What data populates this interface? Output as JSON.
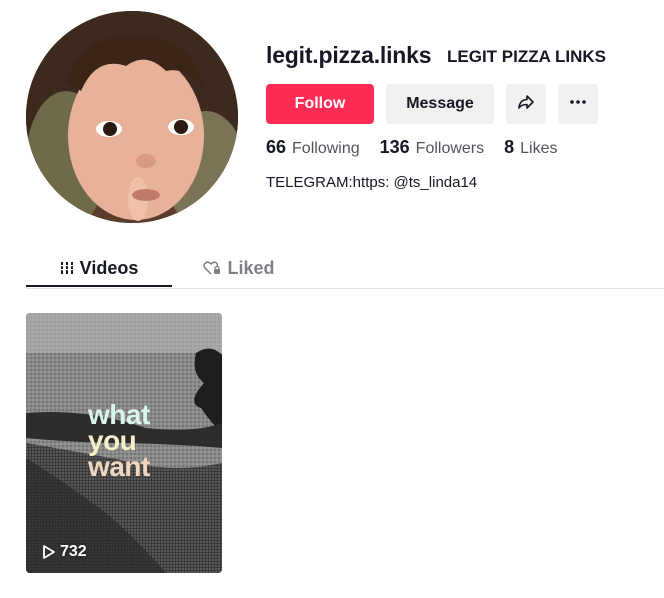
{
  "profile": {
    "username": "legit.pizza.links",
    "nickname": "LEGIT PIZZA LINKS",
    "bio": "TELEGRAM:https: @ts_linda14",
    "avatar_icon": "child-portrait-avatar"
  },
  "actions": {
    "follow_label": "Follow",
    "message_label": "Message",
    "share_icon": "share-arrow-icon",
    "more_icon": "more-dots-icon"
  },
  "stats": {
    "following": {
      "value": "66",
      "label": "Following"
    },
    "followers": {
      "value": "136",
      "label": "Followers"
    },
    "likes": {
      "value": "8",
      "label": "Likes"
    }
  },
  "tabs": [
    {
      "label": "Videos",
      "icon": "grid-bars-icon",
      "active": true
    },
    {
      "label": "Liked",
      "icon": "heart-lock-icon",
      "active": false
    }
  ],
  "videos": [
    {
      "overlay_lines": [
        "what",
        "you",
        "want"
      ],
      "views": "732",
      "view_icon": "play-icon"
    }
  ],
  "colors": {
    "accent": "#fe2c55",
    "text": "#161823",
    "button_bg": "#f1f1f2"
  }
}
